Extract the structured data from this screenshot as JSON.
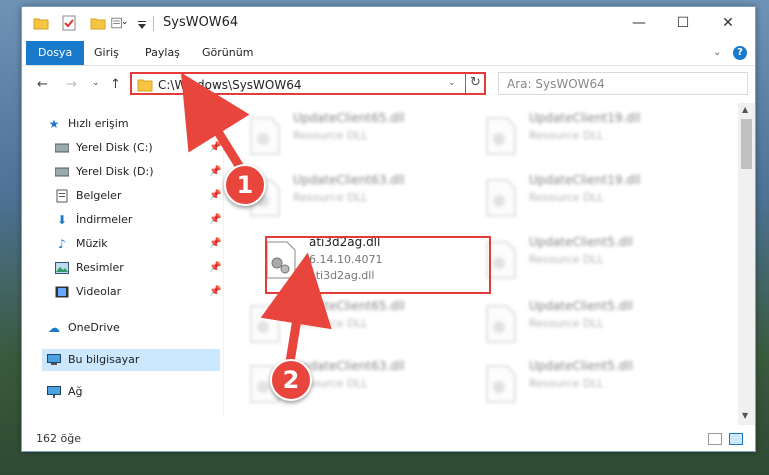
{
  "window": {
    "title": "SysWOW64",
    "controls": {
      "minimize": "—",
      "maximize": "☐",
      "close": "✕"
    }
  },
  "ribbon": {
    "tabs": [
      "Dosya",
      "Giriş",
      "Paylaş",
      "Görünüm"
    ],
    "help": "?"
  },
  "nav": {
    "address": "C:\\Windows\\SysWOW64",
    "search_placeholder": "Ara: SysWOW64"
  },
  "sidebar": {
    "items": [
      {
        "label": "Hızlı erişim",
        "icon": "star-icon",
        "pinned": false
      },
      {
        "label": "Yerel Disk (C:)",
        "icon": "drive-icon",
        "pinned": true
      },
      {
        "label": "Yerel Disk (D:)",
        "icon": "drive-icon",
        "pinned": true
      },
      {
        "label": "Belgeler",
        "icon": "documents-icon",
        "pinned": true
      },
      {
        "label": "İndirmeler",
        "icon": "download-icon",
        "pinned": true
      },
      {
        "label": "Müzik",
        "icon": "music-icon",
        "pinned": true
      },
      {
        "label": "Resimler",
        "icon": "pictures-icon",
        "pinned": true
      },
      {
        "label": "Videolar",
        "icon": "videos-icon",
        "pinned": true
      },
      {
        "label": "OneDrive",
        "icon": "cloud-icon",
        "pinned": false
      },
      {
        "label": "Bu bilgisayar",
        "icon": "computer-icon",
        "pinned": false
      },
      {
        "label": "Ağ",
        "icon": "network-icon",
        "pinned": false
      }
    ]
  },
  "files": {
    "left": [
      {
        "name": "UpdateClient65.dll",
        "detail": "Resource DLL"
      },
      {
        "name": "UpdateClient63.dll",
        "detail": "Resource DLL"
      },
      {
        "name": "ati3d2ag.dll",
        "version": "6.14.10.4071",
        "detail": "ati3d2ag.dll"
      },
      {
        "name": "UpdateClient65.dll",
        "detail": "Resource DLL"
      },
      {
        "name": "UpdateClient63.dll",
        "detail": "Resource DLL"
      }
    ],
    "right": [
      {
        "name": "UpdateClient19.dll",
        "detail": "Resource DLL"
      },
      {
        "name": "UpdateClient19.dll",
        "detail": "Resource DLL"
      },
      {
        "name": "UpdateClient5.dll",
        "detail": "Resource DLL"
      },
      {
        "name": "UpdateClient5.dll",
        "detail": "Resource DLL"
      },
      {
        "name": "UpdateClient5.dll",
        "detail": "Resource DLL"
      }
    ]
  },
  "status": {
    "count": "162 öğe"
  },
  "annotations": {
    "step1": "1",
    "step2": "2"
  },
  "colors": {
    "accent": "#1979ca",
    "highlight": "#e53a3a",
    "badge": "#e8453c"
  }
}
